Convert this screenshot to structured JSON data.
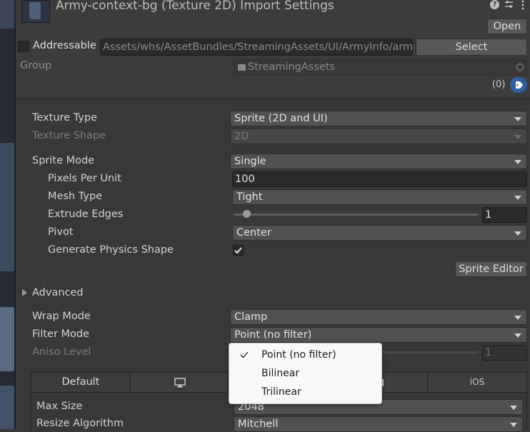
{
  "header": {
    "title": "Army-context-bg (Texture 2D) Import Settings",
    "open_label": "Open",
    "addressable_label": "Addressable",
    "address_path": "Assets/whs/AssetBundles/StreamingAssets/UI/ArmyInfo/arm",
    "select_label": "Select",
    "group_label": "Group",
    "group_value": "StreamingAssets",
    "label_count": "(0)",
    "icons": [
      "help-icon",
      "sliders-icon",
      "kebab-menu-icon",
      "folder-icon",
      "target-icon",
      "tag-icon"
    ]
  },
  "settings": {
    "texture_type": {
      "label": "Texture Type",
      "value": "Sprite (2D and UI)"
    },
    "texture_shape": {
      "label": "Texture Shape",
      "value": "2D"
    },
    "sprite_mode": {
      "label": "Sprite Mode",
      "value": "Single"
    },
    "pixels_per_unit": {
      "label": "Pixels Per Unit",
      "value": "100"
    },
    "mesh_type": {
      "label": "Mesh Type",
      "value": "Tight"
    },
    "extrude_edges": {
      "label": "Extrude Edges",
      "value": "1",
      "slider_fraction": 0.03
    },
    "pivot": {
      "label": "Pivot",
      "value": "Center"
    },
    "generate_physics": {
      "label": "Generate Physics Shape",
      "checked": true
    },
    "sprite_editor_label": "Sprite Editor",
    "advanced_label": "Advanced",
    "wrap_mode": {
      "label": "Wrap Mode",
      "value": "Clamp"
    },
    "filter_mode": {
      "label": "Filter Mode",
      "value": "Point (no filter)"
    },
    "aniso_level": {
      "label": "Aniso Level",
      "value": "1"
    }
  },
  "filter_menu": {
    "options": [
      "Point (no filter)",
      "Bilinear",
      "Trilinear"
    ],
    "selected": "Point (no filter)"
  },
  "platform_tabs": {
    "tabs": [
      {
        "label": "Default",
        "icon": ""
      },
      {
        "label": "",
        "icon": "monitor-icon"
      },
      {
        "label": "",
        "icon": ""
      },
      {
        "label": "",
        "icon": "android-icon"
      },
      {
        "label": "iOS",
        "icon": ""
      }
    ],
    "max_size": {
      "label": "Max Size",
      "value": "2048"
    },
    "resize_algorithm": {
      "label": "Resize Algorithm",
      "value": "Mitchell"
    }
  },
  "colors": {
    "background": "#383838",
    "header_background": "#3c3c3c",
    "tag_badge": "#2f5fa0",
    "menu_background": "#f9f9f9"
  }
}
